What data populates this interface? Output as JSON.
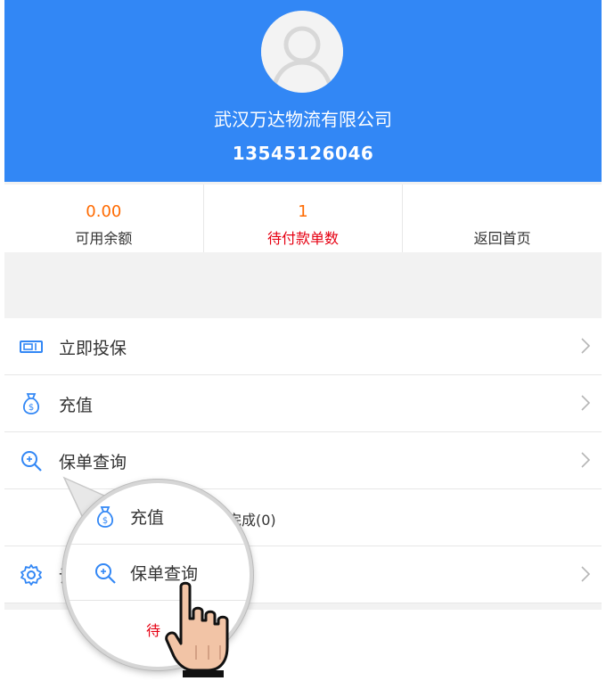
{
  "profile": {
    "company": "武汉万达物流有限公司",
    "phone": "13545126046"
  },
  "stats": [
    {
      "value": "0.00",
      "label": "可用余额"
    },
    {
      "value": "1",
      "label": "待付款单数"
    },
    {
      "value": "",
      "label": "返回首页"
    }
  ],
  "menu": {
    "items": [
      {
        "label": "立即投保",
        "icon": "ticket-icon"
      },
      {
        "label": "充值",
        "icon": "money-bag-icon"
      },
      {
        "label": "保单查询",
        "icon": "search-icon"
      }
    ],
    "status_partial": "完成(0)",
    "settings_partial": "设"
  },
  "magnifier": {
    "items": [
      {
        "label": "充值",
        "icon": "money-bag-icon"
      },
      {
        "label": "保单查询",
        "icon": "search-icon"
      }
    ],
    "partial_red": "待"
  },
  "colors": {
    "header": "#3287f5",
    "accent_orange": "#ff6a00",
    "accent_red": "#e60012",
    "icon_blue": "#3287f5"
  }
}
